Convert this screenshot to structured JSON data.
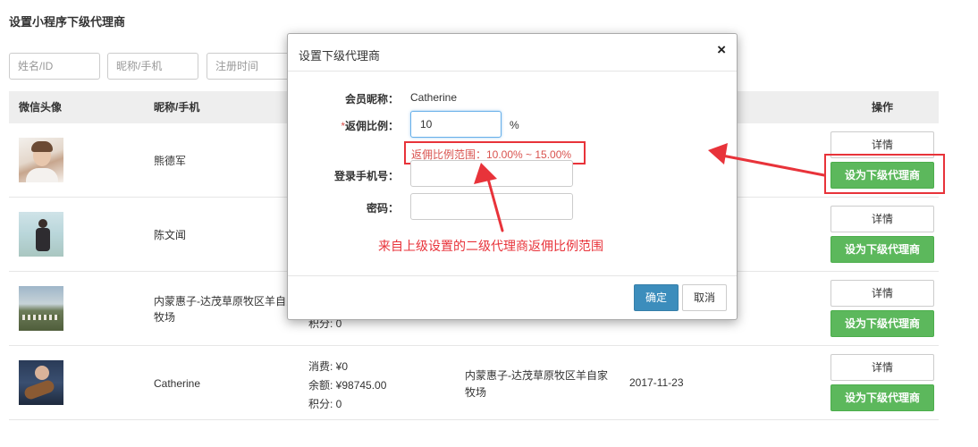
{
  "page": {
    "title": "设置小程序下级代理商"
  },
  "filters": {
    "name_id": "姓名/ID",
    "nick_phone": "昵称/手机",
    "reg_time": "注册时间"
  },
  "table": {
    "headers": {
      "avatar": "微信头像",
      "nick": "昵称/手机",
      "ops": "操作"
    },
    "rows": [
      {
        "nick": "熊德军",
        "detail": "详情",
        "set_agent": "设为下级代理商"
      },
      {
        "nick": "陈文闻",
        "detail": "详情",
        "set_agent": "设为下级代理商"
      },
      {
        "nick": "内蒙惠子-达茂草原牧区羊自家牧场",
        "balance": "积分: 0",
        "detail": "详情",
        "set_agent": "设为下级代理商"
      },
      {
        "nick": "Catherine",
        "spent": "消费: ¥0",
        "balance": "余额: ¥98745.00",
        "points": "积分: 0",
        "region": "内蒙惠子-达茂草原牧区羊自家牧场",
        "date": "2017-11-23",
        "detail": "详情",
        "set_agent": "设为下级代理商"
      }
    ]
  },
  "modal": {
    "title": "设置下级代理商",
    "close": "×",
    "member_nick_label": "会员昵称：",
    "member_nick_value": "Catherine",
    "required_mark": "*",
    "ratio_label": "返佣比例：",
    "ratio_value": "10",
    "ratio_unit": "%",
    "range_hint": "返佣比例范围：10.00% ~ 15.00%",
    "phone_label": "登录手机号：",
    "password_label": "密码：",
    "annotation": "来自上级设置的二级代理商返佣比例范围",
    "ok": "确定",
    "cancel": "取消"
  },
  "colors": {
    "accent_red": "#e8333a",
    "green": "#5cb85c",
    "blue": "#3c8dbc"
  }
}
